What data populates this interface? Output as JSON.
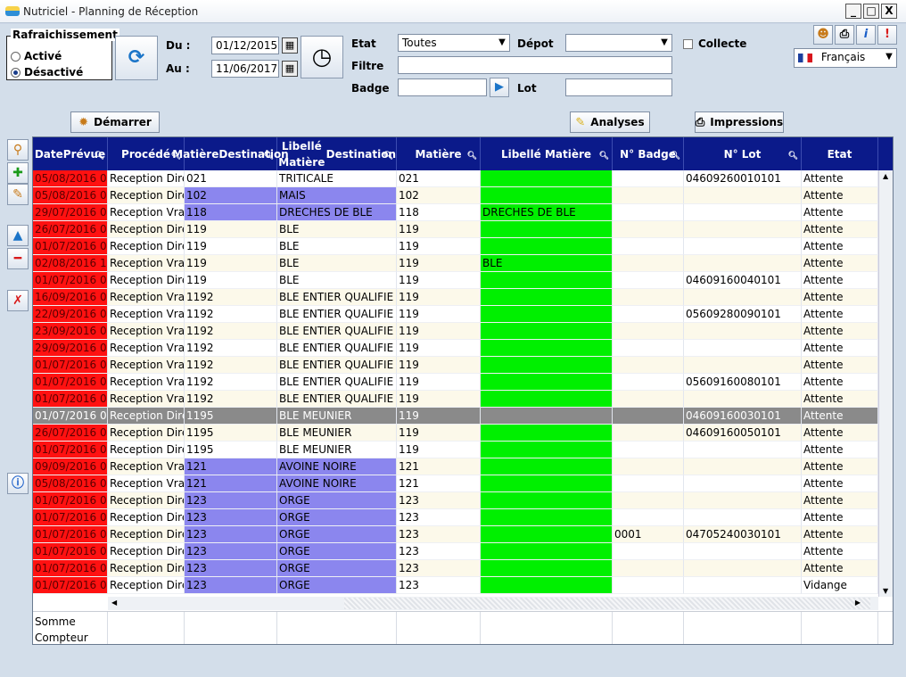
{
  "window": {
    "title": "Nutriciel - Planning de Réception",
    "min": "_",
    "max": "□",
    "close": "X"
  },
  "refresh": {
    "legend": "Rafraichissement",
    "on_label": "Activé",
    "off_label": "Désactivé"
  },
  "dates": {
    "from_label": "Du :",
    "from_value": "01/12/2015",
    "to_label": "Au :",
    "to_value": "11/06/2017"
  },
  "filters": {
    "etat_label": "Etat",
    "etat_value": "Toutes",
    "depot_label": "Dépot",
    "depot_value": "",
    "collecte_label": "Collecte",
    "filtre_label": "Filtre",
    "filtre_value": "",
    "badge_label": "Badge",
    "badge_value": "",
    "lot_label": "Lot",
    "lot_value": ""
  },
  "language": {
    "value": "Français"
  },
  "actions": {
    "start": "Démarrer",
    "analyses": "Analyses",
    "print": "Impressions"
  },
  "columns": [
    {
      "label1": "Date",
      "label2": "Prévue"
    },
    {
      "label1": "Procédé",
      "label2": ""
    },
    {
      "label1": "Matière",
      "label2": "Destination"
    },
    {
      "label1": "Libellé Matière",
      "label2": "Destination"
    },
    {
      "label1": "Matière",
      "label2": ""
    },
    {
      "label1": "Libellé Matière",
      "label2": ""
    },
    {
      "label1": "N° Badge",
      "label2": ""
    },
    {
      "label1": "N° Lot",
      "label2": ""
    },
    {
      "label1": "Etat",
      "label2": ""
    }
  ],
  "rows": [
    [
      "05/08/2016 0",
      "Reception Dire",
      "021",
      "TRITICALE",
      "021",
      "",
      "",
      "04609260010101",
      "Attente"
    ],
    [
      "05/08/2016 0",
      "Reception Dire",
      "102",
      "MAIS",
      "102",
      "",
      "",
      "",
      "Attente"
    ],
    [
      "29/07/2016 0",
      "Reception Vrac",
      "118",
      "DRECHES DE BLE",
      "118",
      "DRECHES DE BLE",
      "",
      "",
      "Attente"
    ],
    [
      "26/07/2016 0",
      "Reception Dire",
      "119",
      "BLE",
      "119",
      "",
      "",
      "",
      "Attente"
    ],
    [
      "01/07/2016 0",
      "Reception Dire",
      "119",
      "BLE",
      "119",
      "",
      "",
      "",
      "Attente"
    ],
    [
      "02/08/2016 1",
      "Reception Vrac",
      "119",
      "BLE",
      "119",
      "BLE",
      "",
      "",
      "Attente"
    ],
    [
      "01/07/2016 0",
      "Reception Dire",
      "119",
      "BLE",
      "119",
      "",
      "",
      "04609160040101",
      "Attente"
    ],
    [
      "16/09/2016 0",
      "Reception Vrac",
      "1192",
      "BLE ENTIER QUALIFIE",
      "119",
      "",
      "",
      "",
      "Attente"
    ],
    [
      "22/09/2016 0",
      "Reception Vrac",
      "1192",
      "BLE ENTIER QUALIFIE",
      "119",
      "",
      "",
      "05609280090101",
      "Attente"
    ],
    [
      "23/09/2016 0",
      "Reception Vrac",
      "1192",
      "BLE ENTIER QUALIFIE",
      "119",
      "",
      "",
      "",
      "Attente"
    ],
    [
      "29/09/2016 0",
      "Reception Vrac",
      "1192",
      "BLE ENTIER QUALIFIE",
      "119",
      "",
      "",
      "",
      "Attente"
    ],
    [
      "01/07/2016 0",
      "Reception Vrac",
      "1192",
      "BLE ENTIER QUALIFIE",
      "119",
      "",
      "",
      "",
      "Attente"
    ],
    [
      "01/07/2016 0",
      "Reception Vrac",
      "1192",
      "BLE ENTIER QUALIFIE",
      "119",
      "",
      "",
      "05609160080101",
      "Attente"
    ],
    [
      "01/07/2016 0",
      "Reception Vrac",
      "1192",
      "BLE ENTIER QUALIFIE",
      "119",
      "",
      "",
      "",
      "Attente"
    ],
    [
      "01/07/2016 0",
      "Reception Dire",
      "1195",
      "BLE MEUNIER",
      "119",
      "",
      "",
      "04609160030101",
      "Attente"
    ],
    [
      "26/07/2016 0",
      "Reception Dire",
      "1195",
      "BLE MEUNIER",
      "119",
      "",
      "",
      "04609160050101",
      "Attente"
    ],
    [
      "01/07/2016 0",
      "Reception Dire",
      "1195",
      "BLE MEUNIER",
      "119",
      "",
      "",
      "",
      "Attente"
    ],
    [
      "09/09/2016 0",
      "Reception Vrac",
      "121",
      "AVOINE NOIRE",
      "121",
      "",
      "",
      "",
      "Attente"
    ],
    [
      "05/08/2016 0",
      "Reception Vrac",
      "121",
      "AVOINE NOIRE",
      "121",
      "",
      "",
      "",
      "Attente"
    ],
    [
      "01/07/2016 0",
      "Reception Dire",
      "123",
      "ORGE",
      "123",
      "",
      "",
      "",
      "Attente"
    ],
    [
      "01/07/2016 0",
      "Reception Dire",
      "123",
      "ORGE",
      "123",
      "",
      "",
      "",
      "Attente"
    ],
    [
      "01/07/2016 0",
      "Reception Dire",
      "123",
      "ORGE",
      "123",
      "",
      "0001",
      "04705240030101",
      "Attente"
    ],
    [
      "01/07/2016 0",
      "Reception Dire",
      "123",
      "ORGE",
      "123",
      "",
      "",
      "",
      "Attente"
    ],
    [
      "01/07/2016 0",
      "Reception Dire",
      "123",
      "ORGE",
      "123",
      "",
      "",
      "",
      "Attente"
    ],
    [
      "01/07/2016 0",
      "Reception Dire",
      "123",
      "ORGE",
      "123",
      "",
      "",
      "",
      "Vidange"
    ]
  ],
  "purple_rows": [
    1,
    2,
    17,
    18,
    19,
    20,
    21,
    22,
    23,
    24
  ],
  "selected_row": 14,
  "footer": {
    "sum": "Somme",
    "count": "Compteur"
  }
}
